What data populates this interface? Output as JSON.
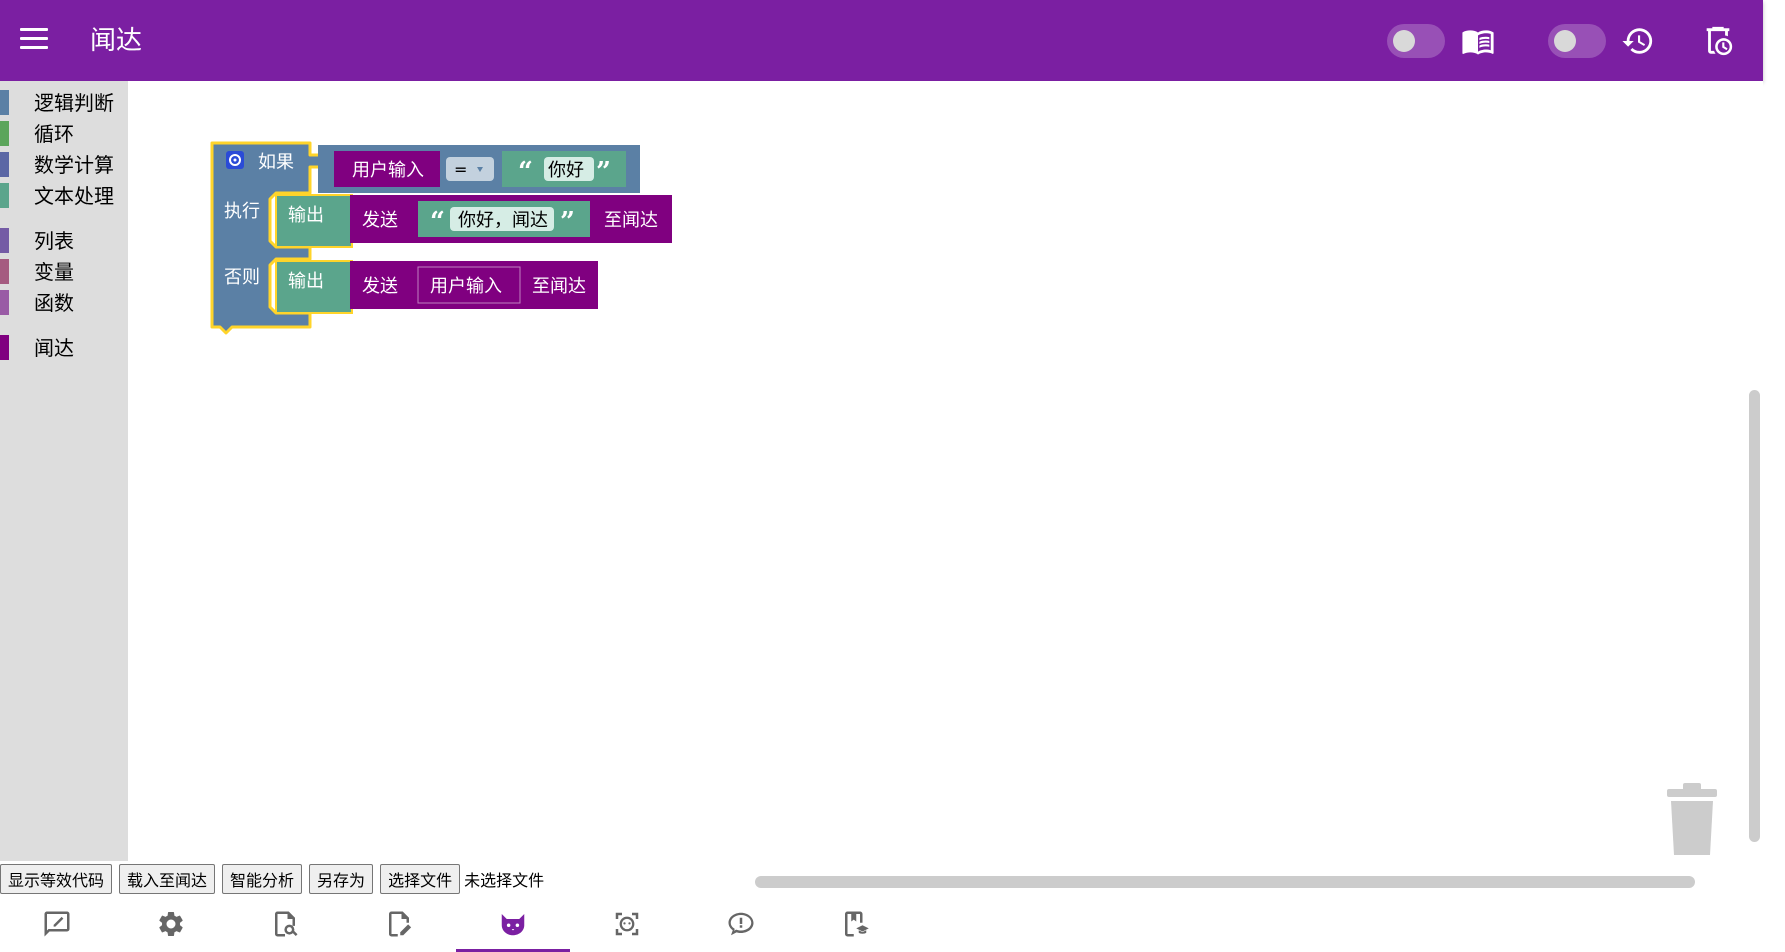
{
  "header": {
    "title": "闻达",
    "menu_icon": "hamburger-menu-icon",
    "toggle_1": {
      "state": "off"
    },
    "knowledge_icon": "open-book-icon",
    "toggle_2": {
      "state": "off"
    },
    "history_icon": "history-icon",
    "clear_history_icon": "delete-clock-icon",
    "background_color": "#7b1fa2"
  },
  "toolbox": {
    "categories": [
      {
        "label": "逻辑判断",
        "color": "#5b80a5"
      },
      {
        "label": "循环",
        "color": "#5ba55b"
      },
      {
        "label": "数学计算",
        "color": "#5b67a5"
      },
      {
        "label": "文本处理",
        "color": "#5ba58c"
      },
      {
        "label": "列表",
        "color": "#745ba5"
      },
      {
        "label": "变量",
        "color": "#a55b80"
      },
      {
        "label": "函数",
        "color": "#995ba5"
      },
      {
        "label": "闻达",
        "color": "#800080"
      }
    ]
  },
  "workspace": {
    "if_block": {
      "if_label": "如果",
      "do_label": "执行",
      "else_label": "否则",
      "color": "#5b80a5",
      "gear_icon": "gear-icon"
    },
    "condition": {
      "left_var": "用户输入",
      "operator": "=",
      "right_text": "你好"
    },
    "then_branch": {
      "output_label": "输出",
      "send_label": "发送",
      "text_value": "你好，闻达",
      "to_label": "至闻达"
    },
    "else_branch": {
      "output_label": "输出",
      "send_label": "发送",
      "var_value": "用户输入",
      "to_label": "至闻达"
    },
    "trash_icon": "trash-can-icon"
  },
  "buttons": {
    "show_code": "显示等效代码",
    "load": "载入至闻达",
    "analyze": "智能分析",
    "save_as": "另存为",
    "choose_file": "选择文件",
    "file_status": "未选择文件"
  },
  "bottom_nav": {
    "items": [
      {
        "icon": "chat-edit-icon"
      },
      {
        "icon": "settings-gear-icon"
      },
      {
        "icon": "document-search-icon"
      },
      {
        "icon": "document-edit-icon"
      },
      {
        "icon": "cat-icon",
        "active": true
      },
      {
        "icon": "face-scan-icon"
      },
      {
        "icon": "chat-alert-icon"
      },
      {
        "icon": "bookmark-school-icon"
      }
    ],
    "accent": "#7b1fa2"
  }
}
